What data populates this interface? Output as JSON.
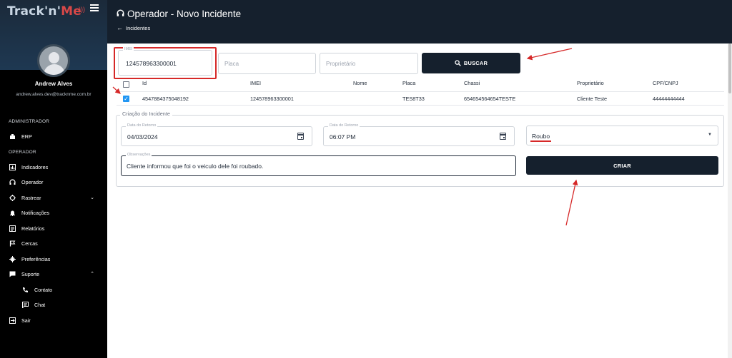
{
  "app": {
    "logo_text": "Track'n'Me",
    "logo_main": "Track'n",
    "logo_sep": "'",
    "logo_accent": "Me"
  },
  "user": {
    "name": "Andrew Alves",
    "email": "andrew.alves.dev@tracknme.com.br"
  },
  "sidebar": {
    "sections": [
      {
        "label": "ADMINISTRADOR"
      },
      {
        "label": "OPERADOR"
      }
    ],
    "items": [
      {
        "label": "ERP",
        "icon": "building-icon"
      },
      {
        "label": "Indicadores",
        "icon": "chart-icon"
      },
      {
        "label": "Operador",
        "icon": "headset-icon"
      },
      {
        "label": "Rastrear",
        "icon": "crosshair-icon"
      },
      {
        "label": "Notificações",
        "icon": "bell-icon"
      },
      {
        "label": "Relatórios",
        "icon": "report-icon"
      },
      {
        "label": "Cercas",
        "icon": "flag-icon"
      },
      {
        "label": "Preferências",
        "icon": "gear-icon"
      },
      {
        "label": "Suporte",
        "icon": "chat-icon"
      },
      {
        "label": "Contato",
        "icon": "phone-icon"
      },
      {
        "label": "Chat",
        "icon": "message-icon"
      },
      {
        "label": "Sair",
        "icon": "exit-icon"
      }
    ]
  },
  "header": {
    "title": "Operador - Novo Incidente",
    "back_label": "Incidentes"
  },
  "search": {
    "imei_label": "IMEI",
    "imei_value": "124578963300001",
    "placa_placeholder": "Placa",
    "proprietario_placeholder": "Proprietário",
    "buscar_label": "BUSCAR"
  },
  "table": {
    "columns": [
      "Id",
      "IMEI",
      "Nome",
      "Placa",
      "Chassi",
      "Proprietário",
      "CPF/CNPJ"
    ],
    "rows": [
      {
        "checked": true,
        "id": "4547884375048192",
        "imei": "124578963300001",
        "nome": "",
        "placa": "TES8T33",
        "chassi": "654654564654TESTE",
        "proprietario": "Cliente Teste",
        "cpf_cnpj": "44444444444"
      }
    ]
  },
  "incident": {
    "legend": "Criação do Incidente",
    "data_label": "Data do Retorno",
    "data_value": "04/03/2024",
    "hora_label": "Data do Retorno",
    "hora_value": "06:07 PM",
    "tipo_value": "Roubo",
    "obs_label": "Observações",
    "obs_value": "Cliente informou que foi o veiculo dele foi roubado.",
    "criar_label": "CRIAR"
  },
  "colors": {
    "header_bg": "#15202d",
    "sidebar_bg": "#000000",
    "accent_red": "#d62828",
    "checkbox_blue": "#2196f3"
  }
}
